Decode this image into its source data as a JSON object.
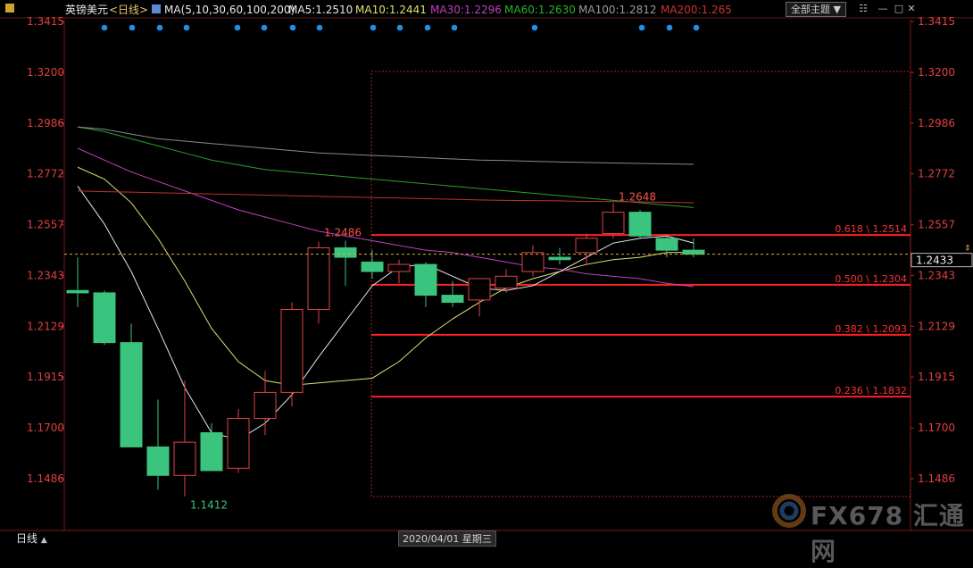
{
  "header": {
    "symbol": "英镑美元",
    "period_tag": "<日线>",
    "ma_params": "MA(5,10,30,60,100,200)",
    "ma5": "MA5:1.2510",
    "ma10": "MA10:1.2441",
    "ma30": "MA30:1.2296",
    "ma60": "MA60:1.2630",
    "ma100": "MA100:1.2812",
    "ma200": "MA200:1.265",
    "topic_button": "全部主题"
  },
  "bottom": {
    "period_tab": "日线",
    "cursor_date": "2020/04/01 星期三"
  },
  "watermark": "FX678 汇通网",
  "colors": {
    "background": "#000000",
    "up_candle": "#e04545",
    "down_candle": "#3ac47d",
    "ma5": "#e8e8e8",
    "ma10": "#e0e070",
    "ma30": "#c040c0",
    "ma60": "#2aa02a",
    "ma100": "#8a8a8a",
    "ma200": "#c03030",
    "axis_text": "#e04040",
    "fib_line": "#ff2020"
  },
  "chart_data": {
    "type": "candlestick",
    "title": "英镑美元",
    "y_ticks": [
      1.3415,
      1.32,
      1.2986,
      1.2772,
      1.2557,
      1.2343,
      1.2129,
      1.1915,
      1.17,
      1.1486
    ],
    "y_tick_labels": [
      "1.3415",
      "1.3200",
      "1.2986",
      "1.2772",
      "1.2557",
      "1.2343",
      "1.2129",
      "1.1915",
      "1.1700",
      "1.1486"
    ],
    "ylim": [
      1.1486,
      1.3415
    ],
    "current_price": 1.2433,
    "current_price_label": "1.2433",
    "high_label": "1.2648",
    "low_label": "1.1412",
    "mid_high_label": "1.2486",
    "candles": [
      {
        "open": 1.228,
        "high": 1.242,
        "low": 1.221,
        "close": 1.227
      },
      {
        "open": 1.227,
        "high": 1.228,
        "low": 1.205,
        "close": 1.206
      },
      {
        "open": 1.206,
        "high": 1.214,
        "low": 1.164,
        "close": 1.162
      },
      {
        "open": 1.162,
        "high": 1.182,
        "low": 1.144,
        "close": 1.15
      },
      {
        "open": 1.15,
        "high": 1.19,
        "low": 1.1412,
        "close": 1.164
      },
      {
        "open": 1.168,
        "high": 1.172,
        "low": 1.153,
        "close": 1.152
      },
      {
        "open": 1.153,
        "high": 1.178,
        "low": 1.151,
        "close": 1.174
      },
      {
        "open": 1.174,
        "high": 1.194,
        "low": 1.167,
        "close": 1.185
      },
      {
        "open": 1.185,
        "high": 1.223,
        "low": 1.179,
        "close": 1.22
      },
      {
        "open": 1.22,
        "high": 1.2486,
        "low": 1.214,
        "close": 1.246
      },
      {
        "open": 1.246,
        "high": 1.249,
        "low": 1.23,
        "close": 1.242
      },
      {
        "open": 1.24,
        "high": 1.245,
        "low": 1.233,
        "close": 1.236
      },
      {
        "open": 1.236,
        "high": 1.241,
        "low": 1.231,
        "close": 1.239
      },
      {
        "open": 1.239,
        "high": 1.24,
        "low": 1.221,
        "close": 1.226
      },
      {
        "open": 1.226,
        "high": 1.232,
        "low": 1.221,
        "close": 1.223
      },
      {
        "open": 1.224,
        "high": 1.233,
        "low": 1.217,
        "close": 1.233
      },
      {
        "open": 1.229,
        "high": 1.237,
        "low": 1.227,
        "close": 1.234
      },
      {
        "open": 1.236,
        "high": 1.247,
        "low": 1.234,
        "close": 1.244
      },
      {
        "open": 1.242,
        "high": 1.246,
        "low": 1.239,
        "close": 1.241
      },
      {
        "open": 1.244,
        "high": 1.252,
        "low": 1.239,
        "close": 1.25
      },
      {
        "open": 1.252,
        "high": 1.2648,
        "low": 1.25,
        "close": 1.261
      },
      {
        "open": 1.261,
        "high": 1.262,
        "low": 1.25,
        "close": 1.251
      },
      {
        "open": 1.25,
        "high": 1.251,
        "low": 1.242,
        "close": 1.245
      },
      {
        "open": 1.245,
        "high": 1.25,
        "low": 1.242,
        "close": 1.2433
      }
    ],
    "ma_lines": [
      {
        "name": "MA5",
        "values": [
          1.272,
          1.256,
          1.236,
          1.212,
          1.187,
          1.168,
          1.165,
          1.172,
          1.184,
          1.2,
          1.215,
          1.23,
          1.238,
          1.239,
          1.234,
          1.229,
          1.228,
          1.23,
          1.236,
          1.242,
          1.248,
          1.25,
          1.251,
          1.248
        ]
      },
      {
        "name": "MA10",
        "values": [
          1.28,
          1.275,
          1.265,
          1.25,
          1.232,
          1.212,
          1.198,
          1.19,
          1.188,
          1.189,
          1.19,
          1.191,
          1.198,
          1.208,
          1.216,
          1.223,
          1.229,
          1.233,
          1.236,
          1.239,
          1.241,
          1.242,
          1.244,
          1.2441
        ]
      },
      {
        "name": "MA30",
        "values": [
          1.288,
          1.283,
          1.278,
          1.274,
          1.27,
          1.266,
          1.262,
          1.259,
          1.256,
          1.253,
          1.251,
          1.249,
          1.247,
          1.245,
          1.244,
          1.242,
          1.24,
          1.238,
          1.237,
          1.235,
          1.234,
          1.233,
          1.231,
          1.2296
        ]
      },
      {
        "name": "MA60",
        "values": [
          1.297,
          1.295,
          1.292,
          1.289,
          1.286,
          1.283,
          1.281,
          1.279,
          1.278,
          1.277,
          1.276,
          1.275,
          1.274,
          1.273,
          1.272,
          1.271,
          1.27,
          1.269,
          1.268,
          1.267,
          1.266,
          1.265,
          1.264,
          1.263
        ]
      },
      {
        "name": "MA100",
        "values": [
          1.297,
          1.296,
          1.294,
          1.292,
          1.291,
          1.29,
          1.289,
          1.288,
          1.287,
          1.286,
          1.2855,
          1.285,
          1.2845,
          1.284,
          1.2835,
          1.283,
          1.2828,
          1.2825,
          1.2822,
          1.282,
          1.2818,
          1.2816,
          1.2814,
          1.2812
        ]
      },
      {
        "name": "MA200",
        "values": [
          1.27,
          1.2697,
          1.2695,
          1.2692,
          1.269,
          1.2687,
          1.2685,
          1.2682,
          1.268,
          1.2677,
          1.2675,
          1.2672,
          1.267,
          1.2667,
          1.2665,
          1.2662,
          1.266,
          1.2659,
          1.2658,
          1.2656,
          1.2655,
          1.2654,
          1.2652,
          1.265
        ]
      }
    ],
    "fibonacci": [
      {
        "ratio": "0.618",
        "price": 1.2514,
        "label": "0.618 \\ 1.2514"
      },
      {
        "ratio": "0.500",
        "price": 1.2304,
        "label": "0.500 \\ 1.2304"
      },
      {
        "ratio": "0.382",
        "price": 1.2093,
        "label": "0.382 \\ 1.2093"
      },
      {
        "ratio": "0.236",
        "price": 1.1832,
        "label": "0.236 \\ 1.1832"
      }
    ],
    "event_dots": 16
  }
}
